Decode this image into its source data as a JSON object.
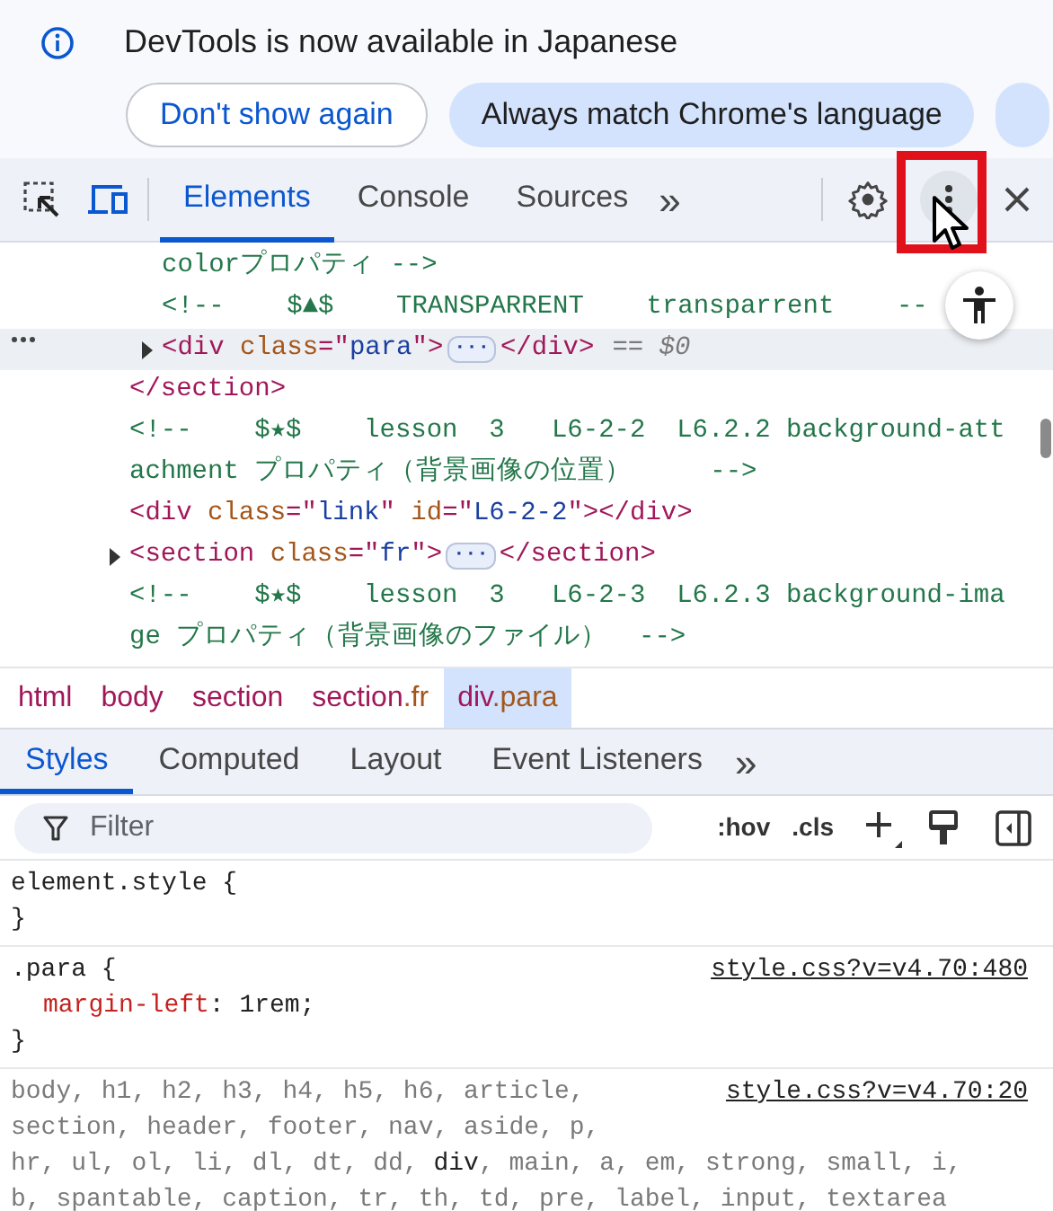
{
  "banner": {
    "message": "DevTools is now available in Japanese",
    "buttons": [
      {
        "label": "Don't show again",
        "kind": "outline"
      },
      {
        "label": "Always match Chrome's language",
        "kind": "filled"
      },
      {
        "kind": "partial"
      }
    ]
  },
  "toolbar": {
    "tabs": [
      {
        "label": "Elements",
        "selected": true
      },
      {
        "label": "Console",
        "selected": false
      },
      {
        "label": "Sources",
        "selected": false
      }
    ],
    "more": "»"
  },
  "dom_tree": [
    {
      "children": [
        {
          "parts": [
            {
              "kind": "comment",
              "t": "colorプロパティ -->"
            }
          ]
        },
        {
          "parts": [
            {
              "kind": "comment",
              "t": "<!--    $▲$    TRANSPARRENT    transparrent    --"
            }
          ]
        },
        {
          "selected": true,
          "expanded": false,
          "parts": [
            {
              "kind": "tag",
              "t": "<div "
            },
            {
              "kind": "attr",
              "t": "class"
            },
            {
              "kind": "tag",
              "t": "=\""
            },
            {
              "kind": "value",
              "t": "para"
            },
            {
              "kind": "tag",
              "t": "\">"
            },
            {
              "kind": "ellipsis",
              "t": "···"
            },
            {
              "kind": "tag",
              "t": "</div>"
            },
            {
              "kind": "note",
              "t": "== $0"
            }
          ]
        }
      ]
    },
    {
      "parts": [
        {
          "kind": "tag",
          "t": "</section>"
        }
      ]
    },
    {
      "parts": [
        {
          "kind": "comment",
          "t": "<!--    $★$    lesson  3   L6-2-2  L6.2.2 background-att"
        }
      ]
    },
    {
      "parts": [
        {
          "kind": "comment",
          "t": "achment プロパティ（背景画像の位置）     -->"
        }
      ]
    },
    {
      "parts": [
        {
          "kind": "tag",
          "t": "<div "
        },
        {
          "kind": "attr",
          "t": "class"
        },
        {
          "kind": "tag",
          "t": "=\""
        },
        {
          "kind": "value",
          "t": "link"
        },
        {
          "kind": "tag",
          "t": "\" "
        },
        {
          "kind": "attr",
          "t": "id"
        },
        {
          "kind": "tag",
          "t": "=\""
        },
        {
          "kind": "value",
          "t": "L6-2-2"
        },
        {
          "kind": "tag",
          "t": "\"></div>"
        }
      ]
    },
    {
      "expanded": false,
      "parts": [
        {
          "kind": "tag",
          "t": "<section "
        },
        {
          "kind": "attr",
          "t": "class"
        },
        {
          "kind": "tag",
          "t": "=\""
        },
        {
          "kind": "value",
          "t": "fr"
        },
        {
          "kind": "tag",
          "t": "\">"
        },
        {
          "kind": "ellipsis",
          "t": "···"
        },
        {
          "kind": "tag",
          "t": "</section>"
        }
      ]
    },
    {
      "parts": [
        {
          "kind": "comment",
          "t": "<!--    $★$    lesson  3   L6-2-3  L6.2.3 background-ima"
        }
      ]
    },
    {
      "parts": [
        {
          "kind": "comment",
          "t": "ge プロパティ（背景画像のファイル）  -->"
        }
      ]
    }
  ],
  "breadcrumbs": [
    {
      "tag": "html",
      "selected": false
    },
    {
      "tag": "body",
      "selected": false
    },
    {
      "tag": "section",
      "selected": false
    },
    {
      "tag": "section",
      "cls": ".fr",
      "selected": false
    },
    {
      "tag": "div",
      "cls": ".para",
      "selected": true
    }
  ],
  "styles_tabs": {
    "tabs": [
      {
        "label": "Styles",
        "selected": true
      },
      {
        "label": "Computed",
        "selected": false
      },
      {
        "label": "Layout",
        "selected": false
      },
      {
        "label": "Event Listeners",
        "selected": false
      }
    ],
    "more": "»"
  },
  "filter": {
    "placeholder": "Filter",
    "hov": ":hov",
    "cls": ".cls"
  },
  "rules": [
    {
      "selector_lines": [
        [
          {
            "text": "element.style {",
            "matched": true
          }
        ]
      ],
      "close": "}"
    },
    {
      "selector_lines": [
        [
          {
            "text": ".para {",
            "matched": true
          }
        ]
      ],
      "source": "style.css?v=v4.70:480",
      "declarations": [
        {
          "property": "margin-left",
          "value": ": 1rem;"
        }
      ],
      "close": "}"
    },
    {
      "selector_lines": [
        [
          {
            "text": "body, h1, h2, h3, h4, h5, h6, article,",
            "matched": false
          }
        ],
        [
          {
            "text": "section, header, footer, nav, aside, p,",
            "matched": false
          }
        ],
        [
          {
            "text": "hr, ul, ol, li, dl, dt, dd, ",
            "matched": false
          },
          {
            "text": "div",
            "matched": true
          },
          {
            "text": ", main, a, em, strong, small, i,",
            "matched": false
          }
        ],
        [
          {
            "text": "b, spantable, caption, tr, th, td, pre, label, input, textarea",
            "matched": false
          }
        ]
      ],
      "source": "style.css?v=v4.70:20"
    }
  ]
}
